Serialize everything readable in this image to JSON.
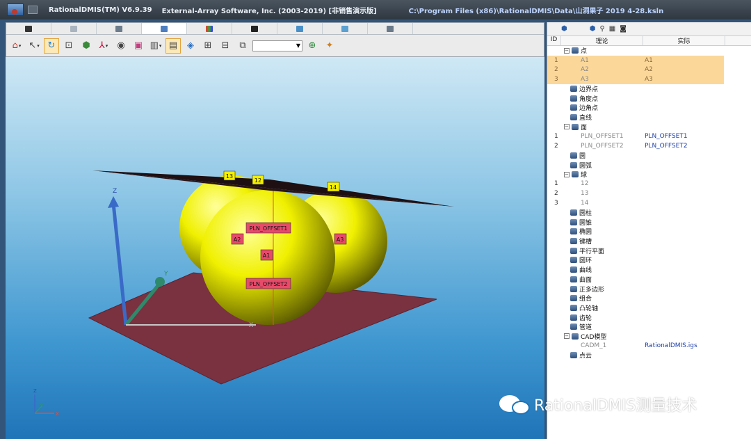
{
  "titlebar": {
    "app": "RationalDMIS(TM) V6.9.39",
    "vendor": "External-Array Software, Inc. (2003-2019) [非销售演示版]",
    "path": "C:\\Program Files (x86)\\RationalDMIS\\Data\\山洞果子  2019 4-28.ksln"
  },
  "viewport": {
    "axes": {
      "z": "Z",
      "y": "Y",
      "x": "X"
    },
    "mini_axes": {
      "z": "Z",
      "y": "Y",
      "x": "X"
    },
    "labels": {
      "s13": "13",
      "s12": "12",
      "s14": "14",
      "plane1": "PLN_OFFSET1",
      "plane2": "PLN_OFFSET2",
      "a1": "A1",
      "a2": "A2",
      "a3": "A3"
    }
  },
  "panel": {
    "columns": {
      "id": "ID",
      "nominal": "理论",
      "actual": "实际"
    },
    "rows": [
      {
        "id": "",
        "name": "点",
        "actual": "",
        "kind": "group",
        "exp": "⊟",
        "indent": 0,
        "sel": false
      },
      {
        "id": "1",
        "name": "A1",
        "actual": "A1",
        "kind": "leaf",
        "exp": "",
        "indent": 1,
        "sel": true
      },
      {
        "id": "2",
        "name": "A2",
        "actual": "A2",
        "kind": "leaf",
        "exp": "",
        "indent": 1,
        "sel": true
      },
      {
        "id": "3",
        "name": "A3",
        "actual": "A3",
        "kind": "leaf",
        "exp": "",
        "indent": 1,
        "sel": true
      },
      {
        "id": "",
        "name": "边界点",
        "actual": "",
        "kind": "group",
        "exp": "",
        "indent": 0,
        "sel": false
      },
      {
        "id": "",
        "name": "角度点",
        "actual": "",
        "kind": "group",
        "exp": "",
        "indent": 0,
        "sel": false
      },
      {
        "id": "",
        "name": "边角点",
        "actual": "",
        "kind": "group",
        "exp": "",
        "indent": 0,
        "sel": false
      },
      {
        "id": "",
        "name": "直线",
        "actual": "",
        "kind": "group",
        "exp": "",
        "indent": 0,
        "sel": false
      },
      {
        "id": "",
        "name": "面",
        "actual": "",
        "kind": "group",
        "exp": "⊟",
        "indent": 0,
        "sel": false
      },
      {
        "id": "1",
        "name": "PLN_OFFSET1",
        "actual": "PLN_OFFSET1",
        "kind": "leaf",
        "exp": "",
        "indent": 1,
        "sel": false
      },
      {
        "id": "2",
        "name": "PLN_OFFSET2",
        "actual": "PLN_OFFSET2",
        "kind": "leaf",
        "exp": "",
        "indent": 1,
        "sel": false
      },
      {
        "id": "",
        "name": "圆",
        "actual": "",
        "kind": "group",
        "exp": "",
        "indent": 0,
        "sel": false
      },
      {
        "id": "",
        "name": "圆弧",
        "actual": "",
        "kind": "group",
        "exp": "",
        "indent": 0,
        "sel": false
      },
      {
        "id": "",
        "name": "球",
        "actual": "",
        "kind": "group",
        "exp": "⊟",
        "indent": 0,
        "sel": false
      },
      {
        "id": "1",
        "name": "12",
        "actual": "",
        "kind": "leaf",
        "exp": "",
        "indent": 1,
        "sel": false
      },
      {
        "id": "2",
        "name": "13",
        "actual": "",
        "kind": "leaf",
        "exp": "",
        "indent": 1,
        "sel": false
      },
      {
        "id": "3",
        "name": "14",
        "actual": "",
        "kind": "leaf",
        "exp": "",
        "indent": 1,
        "sel": false
      },
      {
        "id": "",
        "name": "圆柱",
        "actual": "",
        "kind": "group",
        "exp": "",
        "indent": 0,
        "sel": false
      },
      {
        "id": "",
        "name": "圆锥",
        "actual": "",
        "kind": "group",
        "exp": "",
        "indent": 0,
        "sel": false
      },
      {
        "id": "",
        "name": "椭圆",
        "actual": "",
        "kind": "group",
        "exp": "",
        "indent": 0,
        "sel": false
      },
      {
        "id": "",
        "name": "键槽",
        "actual": "",
        "kind": "group",
        "exp": "",
        "indent": 0,
        "sel": false
      },
      {
        "id": "",
        "name": "平行平面",
        "actual": "",
        "kind": "group",
        "exp": "",
        "indent": 0,
        "sel": false
      },
      {
        "id": "",
        "name": "圆环",
        "actual": "",
        "kind": "group",
        "exp": "",
        "indent": 0,
        "sel": false
      },
      {
        "id": "",
        "name": "曲线",
        "actual": "",
        "kind": "group",
        "exp": "",
        "indent": 0,
        "sel": false
      },
      {
        "id": "",
        "name": "曲面",
        "actual": "",
        "kind": "group",
        "exp": "",
        "indent": 0,
        "sel": false
      },
      {
        "id": "",
        "name": "正多边形",
        "actual": "",
        "kind": "group",
        "exp": "",
        "indent": 0,
        "sel": false
      },
      {
        "id": "",
        "name": "组合",
        "actual": "",
        "kind": "group",
        "exp": "",
        "indent": 0,
        "sel": false
      },
      {
        "id": "",
        "name": "凸轮轴",
        "actual": "",
        "kind": "group",
        "exp": "",
        "indent": 0,
        "sel": false
      },
      {
        "id": "",
        "name": "齿轮",
        "actual": "",
        "kind": "group",
        "exp": "",
        "indent": 0,
        "sel": false
      },
      {
        "id": "",
        "name": "管道",
        "actual": "",
        "kind": "group",
        "exp": "",
        "indent": 0,
        "sel": false
      },
      {
        "id": "",
        "name": "CAD模型",
        "actual": "",
        "kind": "group",
        "exp": "⊟",
        "indent": 0,
        "sel": false
      },
      {
        "id": "",
        "name": "CADM_1",
        "actual": "RationalDMIS.igs",
        "kind": "leaf",
        "exp": "",
        "indent": 1,
        "sel": false
      },
      {
        "id": "",
        "name": "点云",
        "actual": "",
        "kind": "group",
        "exp": "",
        "indent": 0,
        "sel": false
      }
    ]
  },
  "watermark": {
    "text": "RationalDMIS测量技术"
  }
}
